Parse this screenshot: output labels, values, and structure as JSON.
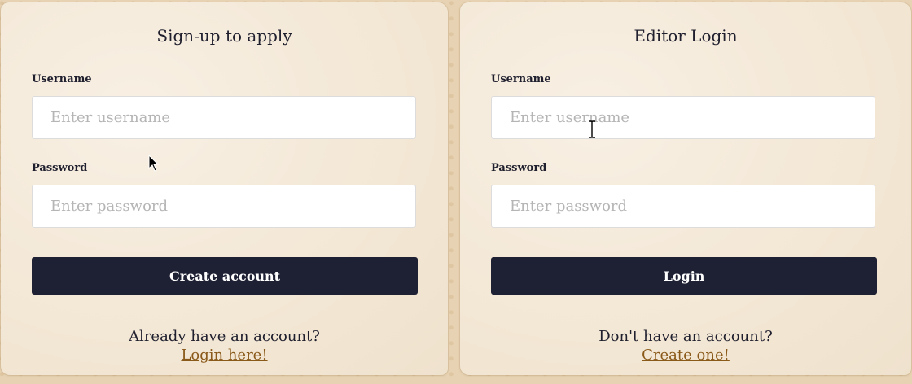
{
  "signup": {
    "title": "Sign-up to apply",
    "username_label": "Username",
    "username_placeholder": "Enter username",
    "password_label": "Password",
    "password_placeholder": "Enter password",
    "submit_label": "Create account",
    "footer_text": "Already have an account?",
    "footer_link": "Login here!"
  },
  "login": {
    "title": "Editor Login",
    "username_label": "Username",
    "username_placeholder": "Enter username",
    "password_label": "Password",
    "password_placeholder": "Enter password",
    "submit_label": "Login",
    "footer_text": "Don't have an account?",
    "footer_link": "Create one!"
  },
  "colors": {
    "button_bg": "#1e2033",
    "link": "#8a5a1a",
    "card_bg": "#f5ebdc",
    "page_bg": "#e7d3b3"
  },
  "icons": {
    "pointer": "arrow-cursor-icon",
    "text_cursor": "i-beam-cursor-icon"
  }
}
